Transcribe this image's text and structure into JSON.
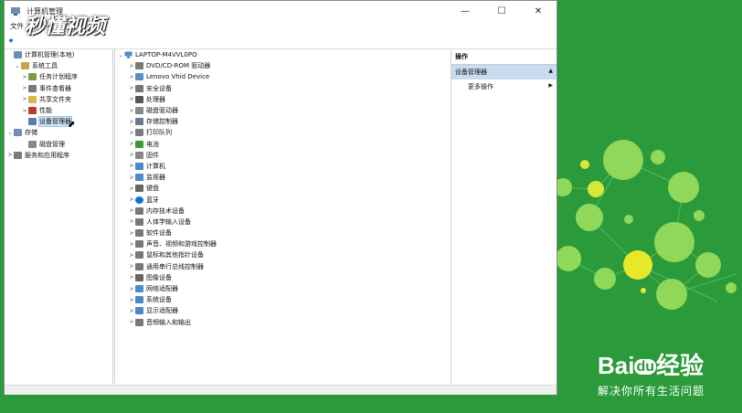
{
  "window": {
    "title": "计算机管理",
    "controls": {
      "minimize": "—",
      "maximize": "☐",
      "close": "✕"
    }
  },
  "menubar": {
    "file": "文件"
  },
  "watermark": {
    "text": "秒懂视频"
  },
  "left_tree": [
    {
      "label": "计算机管理(本地)",
      "level": 0,
      "arrow": "",
      "icon": "computer-management-icon",
      "color": "#6b8fb5"
    },
    {
      "label": "系统工具",
      "level": 1,
      "arrow": "⌄",
      "icon": "tools-icon",
      "color": "#c9a24a"
    },
    {
      "label": "任务计划程序",
      "level": 2,
      "arrow": ">",
      "icon": "clock-icon",
      "color": "#7a9c4a"
    },
    {
      "label": "事件查看器",
      "level": 2,
      "arrow": ">",
      "icon": "event-viewer-icon",
      "color": "#7a7a7a"
    },
    {
      "label": "共享文件夹",
      "level": 2,
      "arrow": ">",
      "icon": "shared-folder-icon",
      "color": "#d9b84a"
    },
    {
      "label": "性能",
      "level": 2,
      "arrow": ">",
      "icon": "performance-icon",
      "color": "#c0392b"
    },
    {
      "label": "设备管理器",
      "level": 2,
      "arrow": "",
      "icon": "device-manager-icon",
      "color": "#5a7fa8",
      "selected": true
    },
    {
      "label": "存储",
      "level": 0,
      "arrow": "⌄",
      "icon": "storage-icon",
      "color": "#6b8fb5"
    },
    {
      "label": "磁盘管理",
      "level": 2,
      "arrow": "",
      "icon": "disk-icon",
      "color": "#888888"
    },
    {
      "label": "服务和应用程序",
      "level": 0,
      "arrow": ">",
      "icon": "services-icon",
      "color": "#7a7a7a"
    }
  ],
  "device_tree": {
    "root": {
      "label": "LAPTOP-M4VVL0PO",
      "arrow": "⌄",
      "icon": "computer-icon"
    },
    "items": [
      {
        "label": "DVD/CD-ROM 驱动器",
        "icon": "dvd-icon",
        "color": "#7a7a7a"
      },
      {
        "label": "Lenovo Vhid Device",
        "icon": "hid-device-icon",
        "color": "#5a8fc8"
      },
      {
        "label": "安全设备",
        "icon": "security-device-icon",
        "color": "#777777"
      },
      {
        "label": "处理器",
        "icon": "processor-icon",
        "color": "#555555"
      },
      {
        "label": "磁盘驱动器",
        "icon": "disk-drive-icon",
        "color": "#888888"
      },
      {
        "label": "存储控制器",
        "icon": "storage-controller-icon",
        "color": "#6a7a8a"
      },
      {
        "label": "打印队列",
        "icon": "printer-icon",
        "color": "#7a7a7a"
      },
      {
        "label": "电池",
        "icon": "battery-icon",
        "color": "#3a9a3a"
      },
      {
        "label": "固件",
        "icon": "firmware-icon",
        "color": "#888888"
      },
      {
        "label": "计算机",
        "icon": "computer-icon",
        "color": "#4a8ac8"
      },
      {
        "label": "监视器",
        "icon": "monitor-icon",
        "color": "#4a8ac8"
      },
      {
        "label": "键盘",
        "icon": "keyboard-icon",
        "color": "#666666"
      },
      {
        "label": "蓝牙",
        "icon": "bluetooth-icon",
        "color": "#1a6fd6"
      },
      {
        "label": "内存技术设备",
        "icon": "memory-device-icon",
        "color": "#777777"
      },
      {
        "label": "人体学输入设备",
        "icon": "hid-icon",
        "color": "#777777"
      },
      {
        "label": "软件设备",
        "icon": "software-device-icon",
        "color": "#777777"
      },
      {
        "label": "声音、视频和游戏控制器",
        "icon": "sound-icon",
        "color": "#777777"
      },
      {
        "label": "鼠标和其他指针设备",
        "icon": "mouse-icon",
        "color": "#777777"
      },
      {
        "label": "通用串行总线控制器",
        "icon": "usb-icon",
        "color": "#777777"
      },
      {
        "label": "图像设备",
        "icon": "camera-icon",
        "color": "#666666"
      },
      {
        "label": "网络适配器",
        "icon": "network-adapter-icon",
        "color": "#4a8ac8"
      },
      {
        "label": "系统设备",
        "icon": "system-device-icon",
        "color": "#4a8ac8"
      },
      {
        "label": "显示适配器",
        "icon": "display-adapter-icon",
        "color": "#4a8ac8"
      },
      {
        "label": "音频输入和输出",
        "icon": "audio-io-icon",
        "color": "#777777"
      }
    ]
  },
  "actions": {
    "header": "操作",
    "selected": "设备管理器",
    "more": "更多操作"
  },
  "brand": {
    "name_left": "Bai",
    "name_mid": "du",
    "name_right": "经验",
    "slogan": "解决你所有生活问题"
  },
  "colors": {
    "background": "#2a9a3a",
    "selection": "#cce4f7",
    "action_selected": "#c8dcef"
  }
}
